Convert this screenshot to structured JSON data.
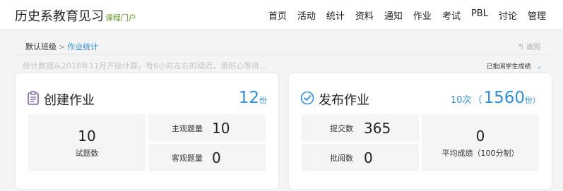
{
  "brand": {
    "title": "历史系教育见习",
    "subtitle": "课程门户"
  },
  "nav": [
    "首页",
    "活动",
    "统计",
    "资料",
    "通知",
    "作业",
    "考试",
    "PBL",
    "讨论",
    "管理"
  ],
  "breadcrumb": {
    "home": "默认班级",
    "separator": ">",
    "current": "作业统计"
  },
  "back_label": "返回",
  "notice": "统计数据从2018年11月开始计算，有6小时左右的延迟，请耐心等待...",
  "filter": {
    "label": "已批阅学生成绩"
  },
  "create": {
    "title": "创建作业",
    "count": "12",
    "unit": "份",
    "cells": {
      "total_value": "10",
      "total_label": "试题数",
      "subjective_label": "主观题量",
      "subjective_value": "10",
      "objective_label": "客观题量",
      "objective_value": "0"
    }
  },
  "publish": {
    "title": "发布作业",
    "times": "10",
    "times_unit": "次",
    "paren_open": "（",
    "count": "1560",
    "unit": "份）",
    "cells": {
      "submitted_label": "提交数",
      "submitted_value": "365",
      "reviewed_label": "批阅数",
      "reviewed_value": "0",
      "avg_value": "0",
      "avg_label": "平均成绩（100分制）"
    }
  },
  "colors": {
    "accent": "#2e8ee0",
    "brand_sub": "#6aa12e",
    "icon_purple": "#7d5fb8",
    "icon_blue": "#2e8ee0"
  },
  "icons": {
    "create": "clipboard-icon",
    "publish": "check-circle-icon",
    "back": "return-arrow-icon",
    "filter": "chevron-down-icon"
  }
}
